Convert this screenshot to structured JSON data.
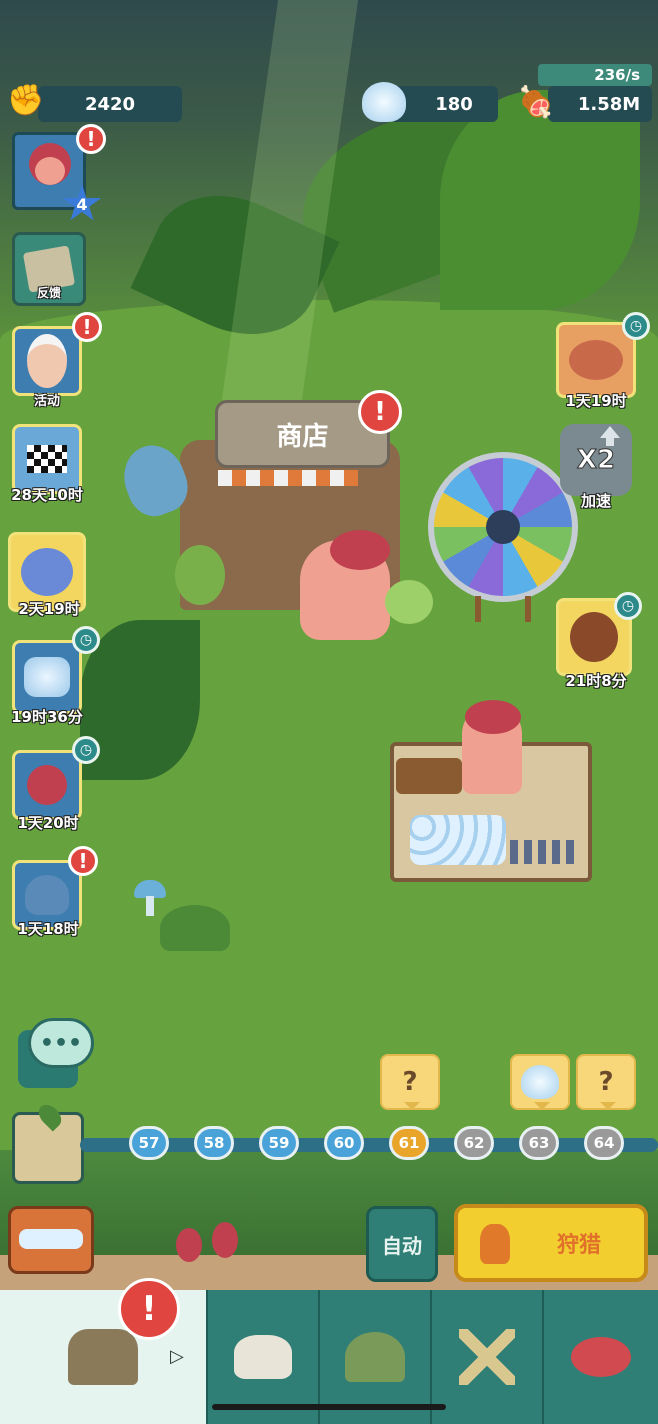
{
  "resources": {
    "power": {
      "value": "2420",
      "icon": "fist-icon"
    },
    "shells": {
      "value": "180",
      "icon": "shell-icon"
    },
    "meat": {
      "value": "1.58M",
      "icon": "meat-icon",
      "rate": "236/s"
    }
  },
  "player": {
    "level": "4"
  },
  "left_menu": [
    {
      "id": "feedback",
      "label": "反馈",
      "icon": "stone-tablet-icon"
    },
    {
      "id": "events",
      "label": "活动",
      "icon": "elder-icon",
      "alert": true
    },
    {
      "id": "race",
      "label": "28天10时",
      "icon": "checkered-flag-icon"
    },
    {
      "id": "dino",
      "label": "2天19时",
      "icon": "blue-dino-icon"
    },
    {
      "id": "bundle1",
      "label": "19时36分",
      "icon": "shell-pile-icon",
      "timer": true
    },
    {
      "id": "bundle2",
      "label": "1天20时",
      "icon": "caveman-meat-icon",
      "timer": true
    },
    {
      "id": "bundle3",
      "label": "1天18时",
      "icon": "mammoth-icon",
      "alert": true
    }
  ],
  "right_menu": [
    {
      "id": "piggy",
      "label": "1天19时",
      "icon": "piggy-bank-icon",
      "timer": true
    },
    {
      "id": "speed",
      "label": "加速",
      "badge": "X2",
      "icon": "speed-boost-icon"
    },
    {
      "id": "gorilla",
      "label": "21时8分",
      "icon": "gorilla-icon",
      "timer": true
    }
  ],
  "shop": {
    "sign": "商店"
  },
  "levels": [
    {
      "n": "57",
      "state": "done"
    },
    {
      "n": "58",
      "state": "done"
    },
    {
      "n": "59",
      "state": "done"
    },
    {
      "n": "60",
      "state": "done"
    },
    {
      "n": "61",
      "state": "current",
      "reward": "?"
    },
    {
      "n": "62",
      "state": "locked"
    },
    {
      "n": "63",
      "state": "locked",
      "reward": "shell"
    },
    {
      "n": "64",
      "state": "locked",
      "reward": "?"
    }
  ],
  "actions": {
    "auto": "自动",
    "hunt": "狩猎"
  },
  "nav_tabs": [
    {
      "id": "shop",
      "icon": "shop-hut-icon",
      "active": true,
      "alert": true
    },
    {
      "id": "fossils",
      "icon": "dino-skull-icon"
    },
    {
      "id": "cave",
      "icon": "cave-icon"
    },
    {
      "id": "weapons",
      "icon": "crossed-weapons-icon"
    },
    {
      "id": "tribe",
      "icon": "cavemen-group-icon"
    }
  ],
  "colors": {
    "hunt_button": "#f2cf2e",
    "auto_button": "#2f7f77",
    "nav_bg": "#2f7f77",
    "alert": "#e0463f"
  }
}
